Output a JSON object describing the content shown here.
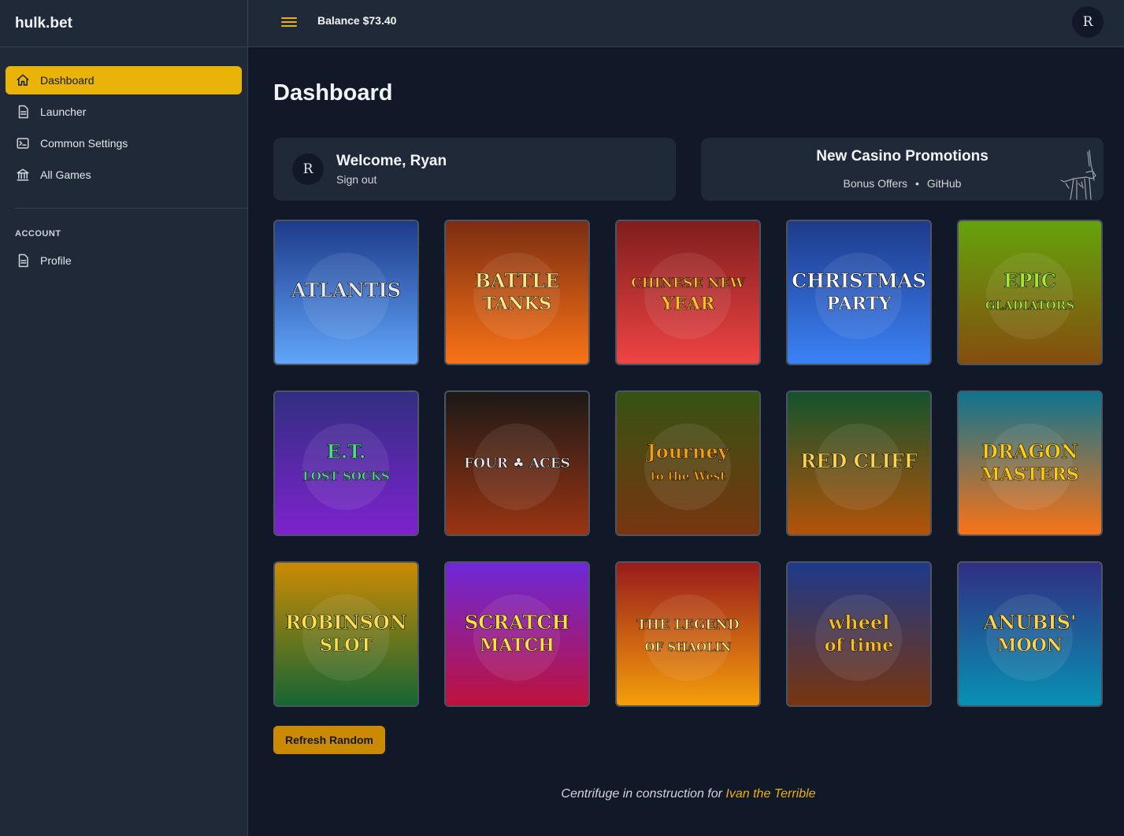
{
  "app": {
    "brand": "hulk.bet"
  },
  "sidebar": {
    "items": [
      {
        "label": "Dashboard",
        "icon": "home-icon",
        "active": true
      },
      {
        "label": "Launcher",
        "icon": "document-icon"
      },
      {
        "label": "Common Settings",
        "icon": "terminal-icon"
      },
      {
        "label": "All Games",
        "icon": "bank-icon"
      }
    ],
    "section_title": "ACCOUNT",
    "account_items": [
      {
        "label": "Profile",
        "icon": "document-icon"
      }
    ]
  },
  "topbar": {
    "balance": "Balance $73.40",
    "avatar_initial": "R",
    "menu_icon": "hamburger-icon",
    "accent": "#eab308"
  },
  "main": {
    "title": "Dashboard",
    "welcome": {
      "avatar_initial": "R",
      "greeting": "Welcome, Ryan",
      "sign_out": "Sign out"
    },
    "promo": {
      "title": "New Casino Promotions",
      "link1": "Bonus Offers",
      "separator": "•",
      "link2": "GitHub"
    },
    "games": [
      {
        "title": "ATLANTIS",
        "sub": "",
        "bg1": "#1e3a8a",
        "bg2": "#60a5fa",
        "fg": "#e5e7eb"
      },
      {
        "title": "BATTLE",
        "sub": "TANKS",
        "bg1": "#7c2d12",
        "bg2": "#f97316",
        "fg": "#fde68a"
      },
      {
        "title": "CHINESE NEW",
        "sub": "YEAR",
        "bg1": "#7f1d1d",
        "bg2": "#ef4444",
        "fg": "#fbbf24"
      },
      {
        "title": "CHRISTMAS",
        "sub": "PARTY",
        "bg1": "#1e3a8a",
        "bg2": "#3b82f6",
        "fg": "#ffffff"
      },
      {
        "title": "EPIC",
        "sub": "GLADIATORS",
        "bg1": "#65a30d",
        "bg2": "#854d0e",
        "fg": "#a3e635"
      },
      {
        "title": "E.T.",
        "sub": "LOST SOCKS",
        "bg1": "#312e81",
        "bg2": "#7e22ce",
        "fg": "#4ade80"
      },
      {
        "title": "FOUR ♣ ACES",
        "sub": "",
        "bg1": "#1c1917",
        "bg2": "#9a3412",
        "fg": "#e5e7eb"
      },
      {
        "title": "Journey",
        "sub": "to the West",
        "bg1": "#365314",
        "bg2": "#78350f",
        "fg": "#f59e0b"
      },
      {
        "title": "RED CLIFF",
        "sub": "",
        "bg1": "#14532d",
        "bg2": "#b45309",
        "fg": "#fcd34d"
      },
      {
        "title": "DRAGON",
        "sub": "MASTERS",
        "bg1": "#0e7490",
        "bg2": "#f97316",
        "fg": "#facc15"
      },
      {
        "title": "ROBINSON",
        "sub": "SLOT",
        "bg1": "#ca8a04",
        "bg2": "#166534",
        "fg": "#fde047"
      },
      {
        "title": "SCRATCH",
        "sub": "MATCH",
        "bg1": "#6d28d9",
        "bg2": "#be123c",
        "fg": "#fde047"
      },
      {
        "title": "THE LEGEND",
        "sub": "OF SHAOLIN",
        "bg1": "#991b1b",
        "bg2": "#f59e0b",
        "fg": "#fde68a"
      },
      {
        "title": "wheel",
        "sub": "of time",
        "bg1": "#1e3a8a",
        "bg2": "#78350f",
        "fg": "#fbbf24"
      },
      {
        "title": "ANUBIS'",
        "sub": "MOON",
        "bg1": "#312e81",
        "bg2": "#0891b2",
        "fg": "#fcd34d"
      }
    ],
    "refresh_label": "Refresh Random"
  },
  "footer": {
    "prefix": "Centrifuge in construction for ",
    "link": "Ivan the Terrible"
  }
}
